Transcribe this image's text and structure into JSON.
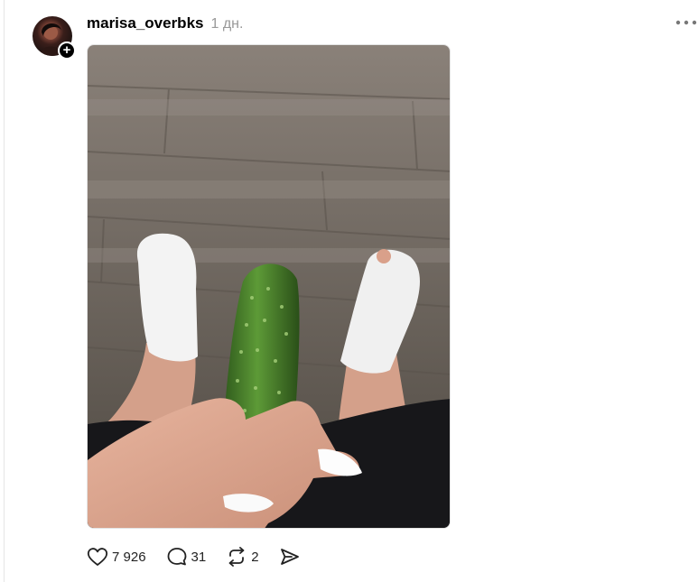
{
  "post": {
    "username": "marisa_overbks",
    "time": "1 дн.",
    "avatar_badge": "+",
    "media_icon": "photo",
    "actions": {
      "like_count": "7 926",
      "comment_count": "31",
      "repost_count": "2"
    }
  },
  "icons": {
    "like": "heart-icon",
    "comment": "comment-icon",
    "repost": "repost-icon",
    "share": "share-icon",
    "more": "more-icon"
  }
}
